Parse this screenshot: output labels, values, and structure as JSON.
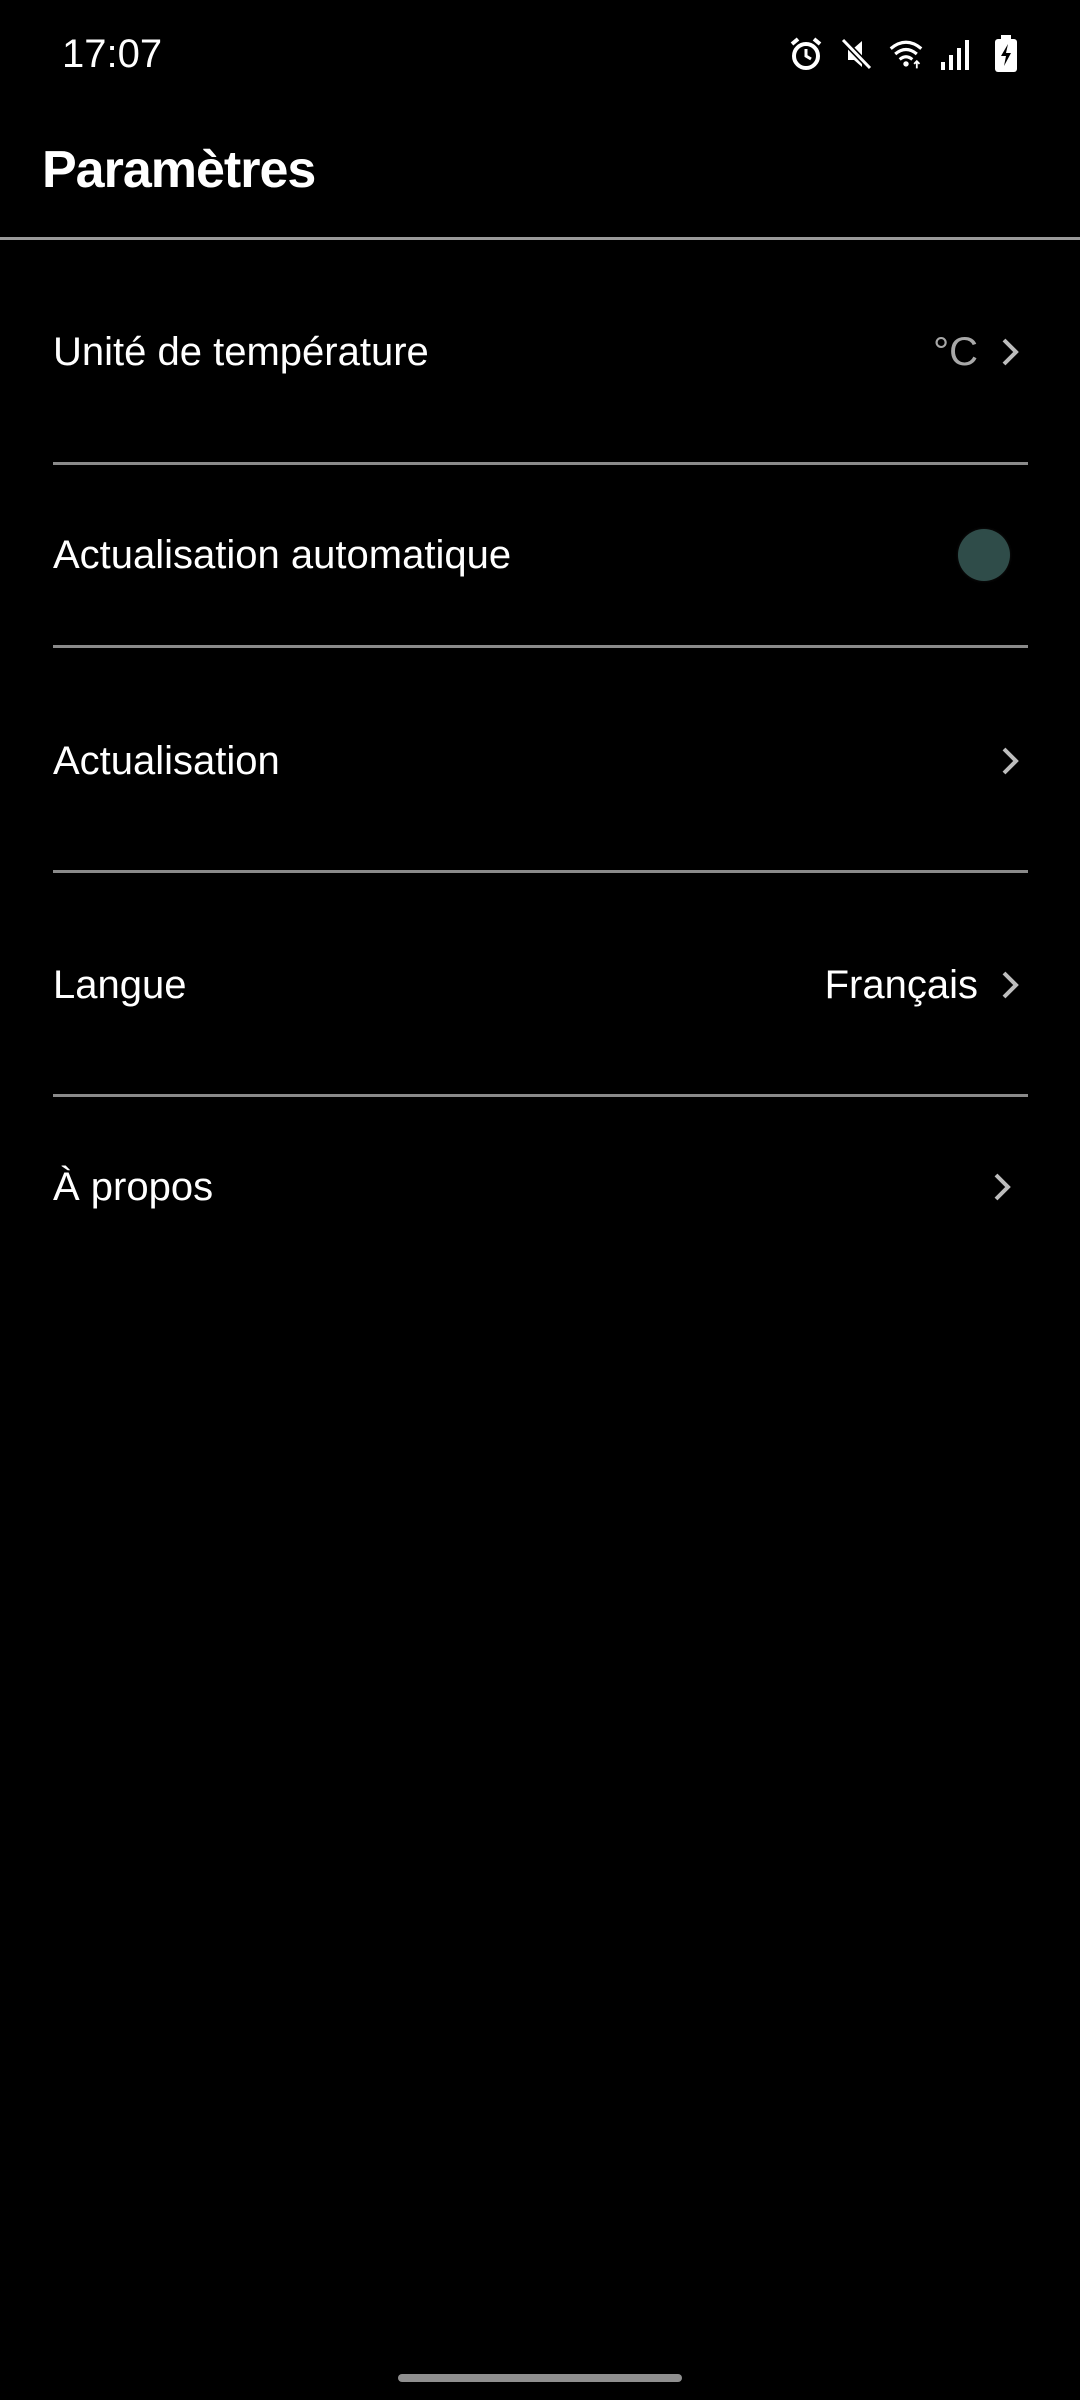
{
  "status_bar": {
    "time": "17:07",
    "icons": [
      "alarm-icon",
      "mute-icon",
      "wifi-icon",
      "signal-icon",
      "battery-charging-icon"
    ]
  },
  "header": {
    "title": "Paramètres"
  },
  "settings": {
    "temperature_unit": {
      "label": "Unité de température",
      "value": "°C"
    },
    "auto_refresh": {
      "label": "Actualisation automatique",
      "toggle_on": false
    },
    "refresh": {
      "label": "Actualisation"
    },
    "language": {
      "label": "Langue",
      "value": "Français"
    },
    "about": {
      "label": "À propos"
    }
  },
  "colors": {
    "background": "#000000",
    "divider": "#8a8a8a",
    "toggle_knob": "#2f4c49",
    "chevron": "#bdbdbd"
  }
}
